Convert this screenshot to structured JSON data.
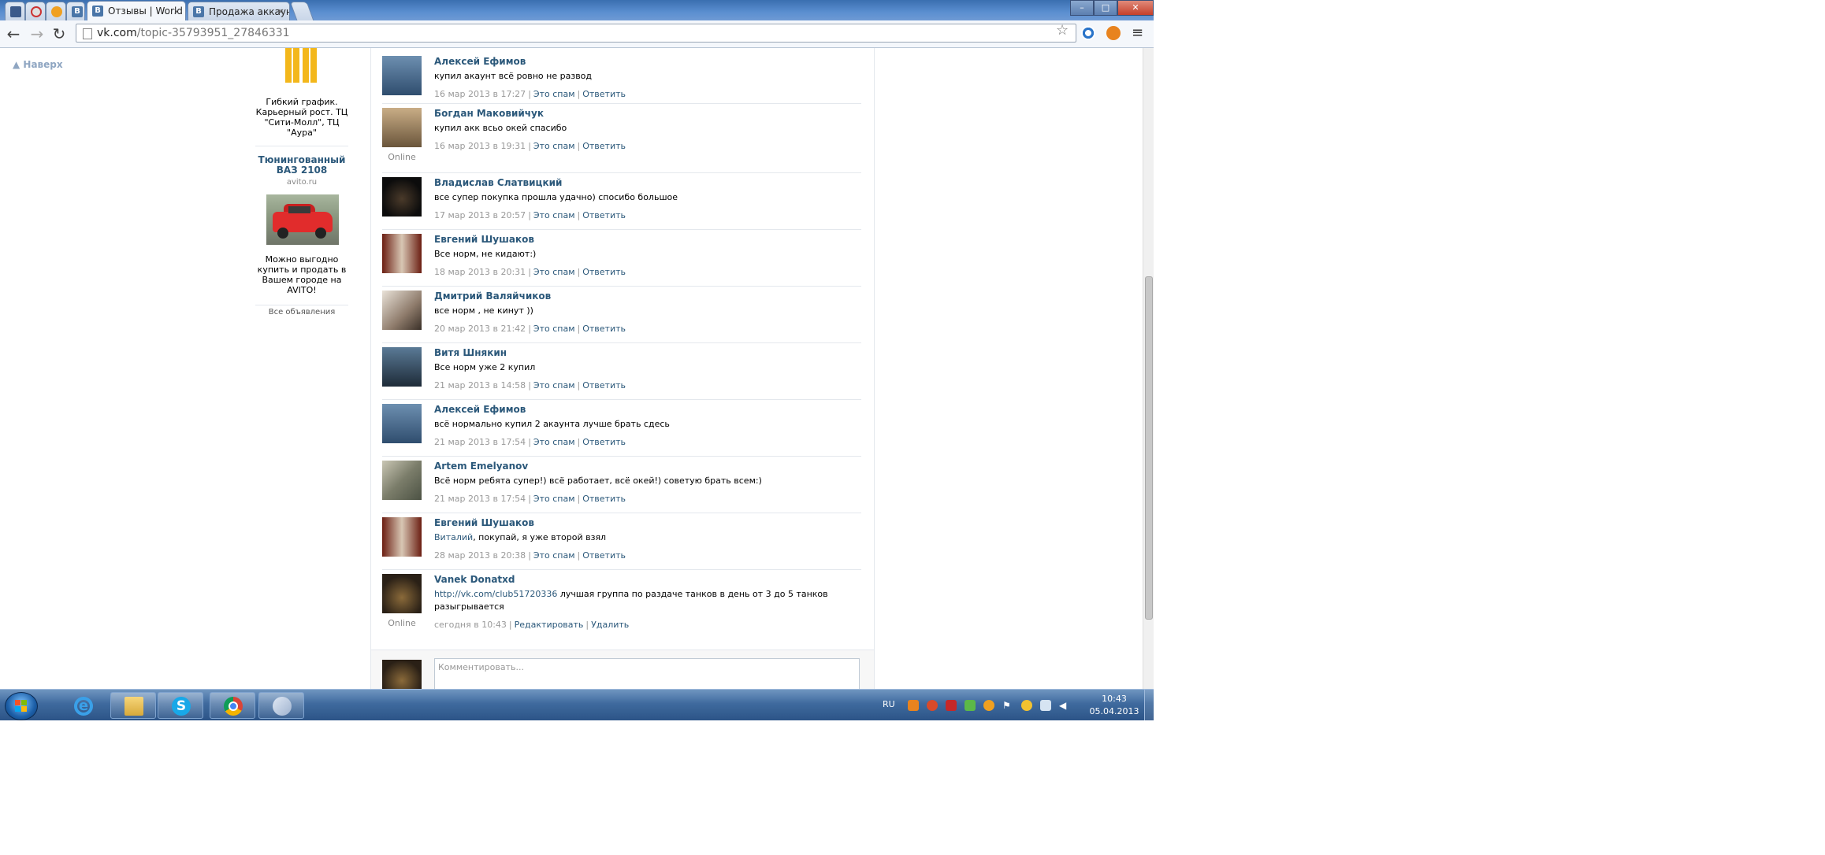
{
  "browser": {
    "tabs": [
      {
        "title": "",
        "icon": "tab-icon-1"
      },
      {
        "title": "",
        "icon": "tab-icon-2"
      },
      {
        "title": "",
        "icon": "tab-icon-3"
      },
      {
        "title": "",
        "icon": "vk-icon"
      },
      {
        "title": "Отзывы | World of tanks",
        "icon": "vk-icon",
        "active": true
      },
      {
        "title": "Продажа аккаунтов World",
        "icon": "vk-icon"
      },
      {
        "title": "",
        "icon": "new-tab"
      }
    ],
    "tab_close": "×",
    "window_controls": {
      "minimize": "–",
      "maximize": "□",
      "close": "✕"
    },
    "address": {
      "host": "vk.com",
      "path": "/topic-35793951_27846331"
    }
  },
  "page": {
    "back_to_top": "Наверх",
    "ads": {
      "ad1_text": "Гибкий график. Карьерный рост. ТЦ \"Сити-Молл\", ТЦ \"Аура\"",
      "ad2_title": "Тюнингованный ВАЗ 2108",
      "ad2_domain": "avito.ru",
      "ad2_text": "Можно выгодно купить и продать в Вашем городе на AVITO!",
      "all_ads": "Все объявления"
    },
    "actions": {
      "spam": "Это спам",
      "reply": "Ответить",
      "edit": "Редактировать",
      "delete": "Удалить",
      "separator": "|"
    },
    "posts": [
      {
        "author": "Алексей Ефимов",
        "text": "купил акаунт всё ровно не развод",
        "date": "16 мар 2013 в 17:27",
        "online": ""
      },
      {
        "author": "Богдан Маковийчук",
        "text": "купил акк всьо окей спасибо",
        "date": "16 мар 2013 в 19:31",
        "online": "Online"
      },
      {
        "author": "Владислав Слатвицкий",
        "text": "все супер покупка прошла удачно) спосибо большое",
        "date": "17 мар 2013 в 20:57",
        "online": ""
      },
      {
        "author": "Евгений Шушаков",
        "text": "Все норм, не кидают:)",
        "date": "18 мар 2013 в 20:31",
        "online": ""
      },
      {
        "author": "Дмитрий Валяйчиков",
        "text": "все норм , не кинут ))",
        "date": "20 мар 2013 в 21:42",
        "online": ""
      },
      {
        "author": "Витя Шнякин",
        "text": "Все норм уже 2 купил",
        "date": "21 мар 2013 в 14:58",
        "online": ""
      },
      {
        "author": "Алексей Ефимов",
        "text": "всё нормально купил 2 акаунта лучше брать сдесь",
        "date": "21 мар 2013 в 17:54",
        "online": ""
      },
      {
        "author": "Artem Emelyanov",
        "text": "Всё норм ребята супер!) всё работает, всё окей!) советую брать всем:)",
        "date": "21 мар 2013 в 17:54",
        "online": ""
      },
      {
        "author": "Евгений Шушаков",
        "text_link": "Виталий",
        "text": ", покупай, я уже второй взял",
        "date": "28 мар 2013 в 20:38",
        "online": ""
      },
      {
        "author": "Vanek Donatxd",
        "text_link": "http://vk.com/club51720336",
        "text": " лучшая группа по раздаче танков в день от 3 до 5 танков разыгрывается",
        "date": "сегодня в 10:43",
        "online": "Online"
      }
    ],
    "comment_placeholder": "Комментировать..."
  },
  "taskbar": {
    "apps": [
      "internet-explorer",
      "file-explorer",
      "skype",
      "chrome",
      "paint"
    ],
    "language": "RU",
    "time": "10:43",
    "date": "05.04.2013"
  },
  "colors": {
    "link": "#2b587a",
    "meta": "#999999",
    "taskbar": "#3f6a9e",
    "mcd_yellow": "#f3b71b"
  }
}
